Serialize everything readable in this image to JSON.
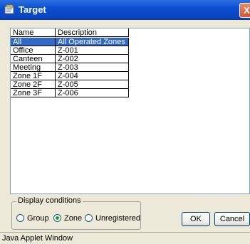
{
  "window": {
    "title": "Target",
    "close_label": "X"
  },
  "table": {
    "columns": [
      "Name",
      "Description"
    ],
    "rows": [
      [
        "All",
        "All Operated Zones"
      ],
      [
        "Office",
        "Z-001"
      ],
      [
        "Canteen",
        "Z-002"
      ],
      [
        "Meeting",
        "Z-003"
      ],
      [
        "Zone 1F",
        "Z-004"
      ],
      [
        "Zone 2F",
        "Z-005"
      ],
      [
        "Zone 3F",
        "Z-006"
      ]
    ],
    "selected_index": 0
  },
  "display_conditions": {
    "legend": "Display conditions",
    "options": [
      "Group",
      "Zone",
      "Unregistered"
    ],
    "selected": "Zone"
  },
  "buttons": {
    "ok": "OK",
    "cancel": "Cancel"
  },
  "status": "Java Applet Window"
}
